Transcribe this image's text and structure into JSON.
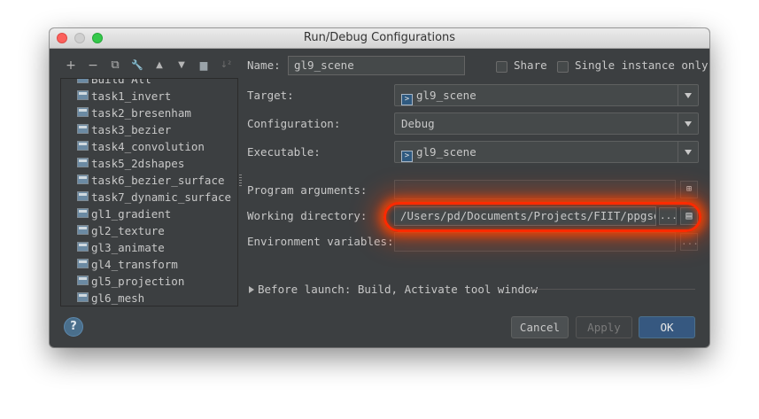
{
  "window": {
    "title": "Run/Debug Configurations"
  },
  "toolbar": {
    "add": "+",
    "remove": "−",
    "copy": "⧉",
    "wrench": "🔧",
    "up": "▲",
    "down": "▼",
    "folder": "▆",
    "sort": "↓²"
  },
  "tree": {
    "items": [
      "Build All",
      "task1_invert",
      "task2_bresenham",
      "task3_bezier",
      "task4_convolution",
      "task5_2dshapes",
      "task6_bezier_surface",
      "task7_dynamic_surface",
      "gl1_gradient",
      "gl2_texture",
      "gl3_animate",
      "gl4_transform",
      "gl5_projection",
      "gl6_mesh"
    ]
  },
  "form": {
    "name_label": "Name:",
    "name_value": "gl9_scene",
    "share_label": "Share",
    "single_instance_label": "Single instance only",
    "target_label": "Target:",
    "target_value": "gl9_scene",
    "configuration_label": "Configuration:",
    "configuration_value": "Debug",
    "executable_label": "Executable:",
    "executable_value": "gl9_scene",
    "program_args_label": "Program arguments:",
    "program_args_value": "",
    "working_dir_label": "Working directory:",
    "working_dir_value": "/Users/pd/Documents/Projects/FIIT/ppgso/c",
    "browse": "...",
    "env_label": "Environment variables:",
    "env_value": "",
    "before_launch": "Before launch: Build, Activate tool window"
  },
  "buttons": {
    "help": "?",
    "cancel": "Cancel",
    "apply": "Apply",
    "ok": "OK"
  },
  "icons": {
    "exe": ">"
  }
}
